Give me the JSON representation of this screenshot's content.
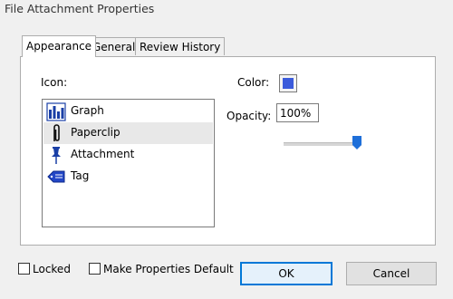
{
  "window": {
    "title": "File Attachment Properties"
  },
  "tabs": [
    {
      "label": "Appearance",
      "active": true
    },
    {
      "label": "General",
      "active": false
    },
    {
      "label": "Review History",
      "active": false
    }
  ],
  "appearance": {
    "icon_label": "Icon:",
    "icons": [
      {
        "label": "Graph",
        "icon": "graph-icon",
        "selected": false
      },
      {
        "label": "Paperclip",
        "icon": "paperclip-icon",
        "selected": true
      },
      {
        "label": "Attachment",
        "icon": "pushpin-icon",
        "selected": false
      },
      {
        "label": "Tag",
        "icon": "tag-icon",
        "selected": false
      }
    ],
    "color_label": "Color:",
    "color_value": "#3b5bdb",
    "opacity_label": "Opacity:",
    "opacity_value": "100%",
    "opacity_level": 1.0
  },
  "footer": {
    "locked_label": "Locked",
    "locked_checked": false,
    "default_label": "Make Properties Default",
    "default_checked": false,
    "ok_label": "OK",
    "cancel_label": "Cancel"
  },
  "colors": {
    "accent": "#0078d7",
    "slider_thumb": "#1e6fd9",
    "icon_blue": "#1a3fa6"
  }
}
